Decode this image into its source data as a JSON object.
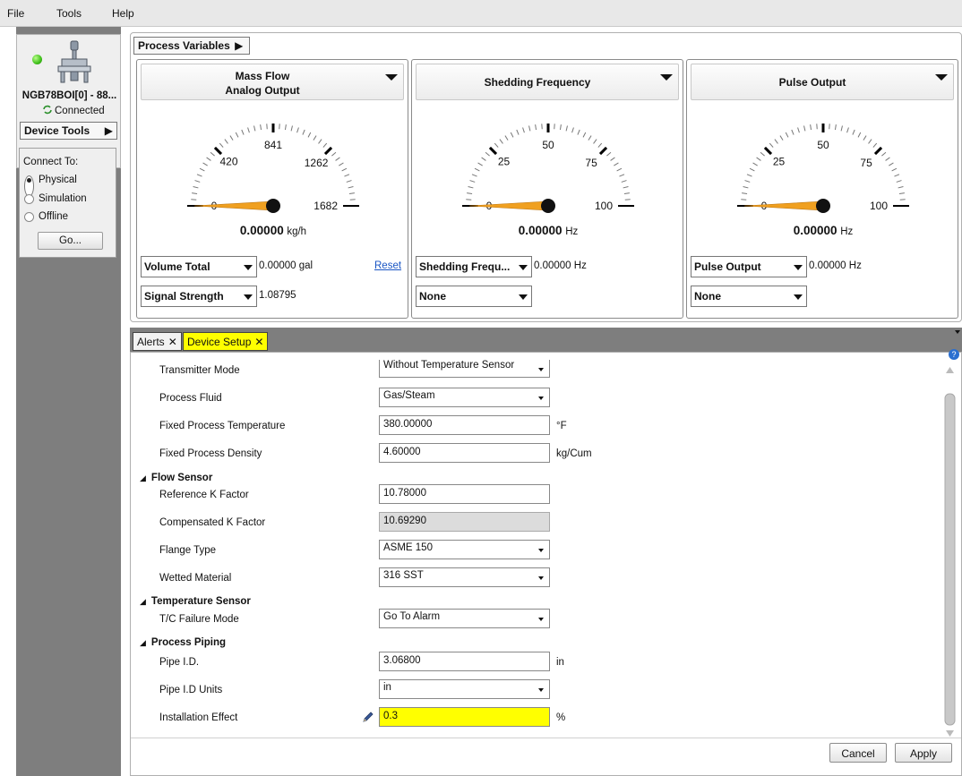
{
  "menu": [
    "File",
    "Tools",
    "Help"
  ],
  "device": {
    "name": "NGB78BOI[0] - 88...",
    "status": "Connected",
    "tools_label": "Device Tools"
  },
  "connect": {
    "title": "Connect To:",
    "options": [
      "Physical",
      "Simulation",
      "Offline"
    ],
    "selected": "Physical",
    "go_label": "Go..."
  },
  "process_variables_label": "Process Variables",
  "gauges": [
    {
      "title_line1": "Mass Flow",
      "title_line2": "Analog Output",
      "ticks": [
        "0",
        "420",
        "841",
        "1262",
        "1682"
      ],
      "min": 0,
      "max": 1682,
      "current": 0,
      "value": "0.00000",
      "unit": "kg/h",
      "row1_select": "Volume Total",
      "row1_value": "0.00000 gal",
      "row1_link": "Reset",
      "row2_select": "Signal Strength",
      "row2_value": "1.08795"
    },
    {
      "title_line1": "Shedding Frequency",
      "title_line2": "",
      "ticks": [
        "0",
        "25",
        "50",
        "75",
        "100"
      ],
      "min": 0,
      "max": 100,
      "current": 0,
      "value": "0.00000",
      "unit": "Hz",
      "row1_select": "Shedding Frequ...",
      "row1_value": "0.00000 Hz",
      "row1_link": "",
      "row2_select": "None",
      "row2_value": ""
    },
    {
      "title_line1": "Pulse Output",
      "title_line2": "",
      "ticks": [
        "0",
        "25",
        "50",
        "75",
        "100"
      ],
      "min": 0,
      "max": 100,
      "current": 0,
      "value": "0.00000",
      "unit": "Hz",
      "row1_select": "Pulse Output",
      "row1_value": "0.00000 Hz",
      "row1_link": "",
      "row2_select": "None",
      "row2_value": ""
    }
  ],
  "tabs": {
    "alerts": "Alerts",
    "device_setup": "Device Setup",
    "active": "Device Setup"
  },
  "setup": {
    "transmitter_mode": {
      "label": "Transmitter Mode",
      "value": "Without Temperature Sensor"
    },
    "process_fluid": {
      "label": "Process Fluid",
      "value": "Gas/Steam"
    },
    "fixed_temp": {
      "label": "Fixed Process Temperature",
      "value": "380.00000",
      "unit": "°F"
    },
    "fixed_density": {
      "label": "Fixed Process Density",
      "value": "4.60000",
      "unit": "kg/Cum"
    },
    "section_flow_sensor": "Flow Sensor",
    "ref_k": {
      "label": "Reference K Factor",
      "value": "10.78000"
    },
    "comp_k": {
      "label": "Compensated K Factor",
      "value": "10.69290"
    },
    "flange_type": {
      "label": "Flange Type",
      "value": "ASME 150"
    },
    "wetted_material": {
      "label": "Wetted Material",
      "value": "316 SST"
    },
    "section_temp_sensor": "Temperature Sensor",
    "tc_failure": {
      "label": "T/C Failure Mode",
      "value": "Go To Alarm"
    },
    "section_piping": "Process Piping",
    "pipe_id": {
      "label": "Pipe I.D.",
      "value": "3.06800",
      "unit": "in"
    },
    "pipe_id_units": {
      "label": "Pipe I.D Units",
      "value": "in"
    },
    "install_effect": {
      "label": "Installation Effect",
      "value": "0.3",
      "unit": "%"
    }
  },
  "buttons": {
    "cancel": "Cancel",
    "apply": "Apply"
  },
  "colors": {
    "needle": "#f0a020",
    "highlight_field": "#ffff00",
    "active_tab": "#ffff00",
    "panel_gray": "#7e7e7e",
    "status_led": "#3fbf1a"
  }
}
